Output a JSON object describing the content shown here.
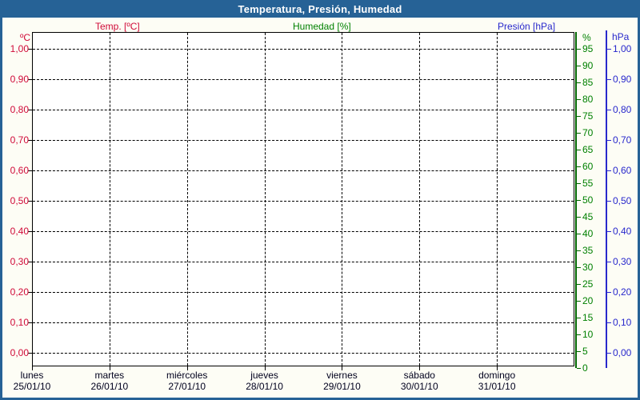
{
  "title_bar": {
    "title": "Temperatura, Presión, Humedad"
  },
  "legend": {
    "temp": "Temp. [ºC]",
    "humidity": "Humedad [%]",
    "pressure": "Presión [hPa]"
  },
  "colors": {
    "frame": "#266296",
    "background": "#fdfdf5",
    "plot_background": "#ffffff",
    "grid": "#000000",
    "temp": "#d00a38",
    "humidity": "#008000",
    "humidity_axis": "#006600",
    "pressure": "#2828cc",
    "day_label": "#00001e",
    "title_text": "#ffffff"
  },
  "chart_data": {
    "type": "line",
    "title": "Temperatura, Presión, Humedad",
    "grid": true,
    "legend_position": "top",
    "series": [
      {
        "name": "Temp. [ºC]",
        "color": "#d00a38",
        "axis": "left-temp",
        "values": []
      },
      {
        "name": "Humedad [%]",
        "color": "#008000",
        "axis": "right-humidity",
        "values": []
      },
      {
        "name": "Presión [hPa]",
        "color": "#2828cc",
        "axis": "right-pressure",
        "values": []
      }
    ],
    "note_series_empty": "no data curves are drawn; axes and grid only",
    "x_axis": {
      "days": [
        {
          "name": "lunes",
          "date": "25/01/10"
        },
        {
          "name": "martes",
          "date": "26/01/10"
        },
        {
          "name": "miércoles",
          "date": "27/01/10"
        },
        {
          "name": "jueves",
          "date": "28/01/10"
        },
        {
          "name": "viernes",
          "date": "29/01/10"
        },
        {
          "name": "sábado",
          "date": "30/01/10"
        },
        {
          "name": "domingo",
          "date": "31/01/10"
        }
      ]
    },
    "y_axes": {
      "temp": {
        "unit": "ºC",
        "range": [
          0,
          1
        ],
        "ticks": [
          "1,00",
          "0,90",
          "0,80",
          "0,70",
          "0,60",
          "0,50",
          "0,40",
          "0,30",
          "0,20",
          "0,10",
          "0,00"
        ]
      },
      "humidity": {
        "unit": "%",
        "range": [
          0,
          95
        ],
        "ticks": [
          "95",
          "90",
          "85",
          "80",
          "75",
          "70",
          "65",
          "60",
          "55",
          "50",
          "45",
          "40",
          "35",
          "30",
          "25",
          "20",
          "15",
          "10",
          "5",
          "0"
        ]
      },
      "pressure": {
        "unit": "hPa",
        "range": [
          0,
          1
        ],
        "ticks": [
          "1,00",
          "0,90",
          "0,80",
          "0,70",
          "0,60",
          "0,50",
          "0,40",
          "0,30",
          "0,20",
          "0,10",
          "0,00"
        ]
      }
    }
  }
}
